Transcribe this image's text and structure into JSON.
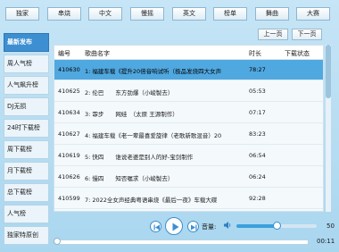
{
  "tabs": [
    "独家",
    "串烧",
    "中文",
    "慢摇",
    "英文",
    "榜单",
    "舞曲",
    "大赛"
  ],
  "sidebar": [
    "最新发布",
    "周人气榜",
    "人气飙升榜",
    "DJ无损",
    "24时下载榜",
    "周下载榜",
    "月下载榜",
    "总下载榜",
    "人气榜",
    "独家特原创"
  ],
  "pager": {
    "prev": "上一页",
    "next": "下一页"
  },
  "table": {
    "headers": {
      "id": "编号",
      "name": "歌曲名字",
      "duration": "时长",
      "status": "下载状态"
    },
    "rows": [
      {
        "id": "410630",
        "name": "1: 福建车载《提升20倍音响试听（极品发烧四大女声",
        "duration": "78:27",
        "selected": true
      },
      {
        "id": "410625",
        "name": "2: 伦巴　　东方劲爆（小峻製去）",
        "duration": "05:53",
        "selected": false
      },
      {
        "id": "410634",
        "name": "3: 霏步　　网娃　（太原 王源制作）",
        "duration": "07:17",
        "selected": false
      },
      {
        "id": "410627",
        "name": "4: 福建车载《老一辈最喜爱旋律（老歌新歌混音）20",
        "duration": "83:23",
        "selected": false
      },
      {
        "id": "410619",
        "name": "5: 快四　　谁说老婆是别人的好-宝剑制作",
        "duration": "06:54",
        "selected": false
      },
      {
        "id": "410626",
        "name": "6: 慢四　　知否嘱求（小峻製去）",
        "duration": "06:24",
        "selected": false
      },
      {
        "id": "410599",
        "name": "7: 2022全女声经典粤语串烧《最后一夜》车载大碟",
        "duration": "92:28",
        "selected": false
      }
    ]
  },
  "volume": {
    "label": "音量:",
    "value": "50",
    "fraction": 0.5
  },
  "progress": {
    "time": "00:11",
    "fraction": 0.0
  },
  "colors": {
    "accent": "#3d8fd1",
    "selected_row": "#50a8e0",
    "background": "#b8ddf2"
  },
  "icons": {
    "prev": "skip-previous-icon",
    "play": "play-icon",
    "next": "skip-next-icon",
    "volume": "speaker-icon"
  }
}
